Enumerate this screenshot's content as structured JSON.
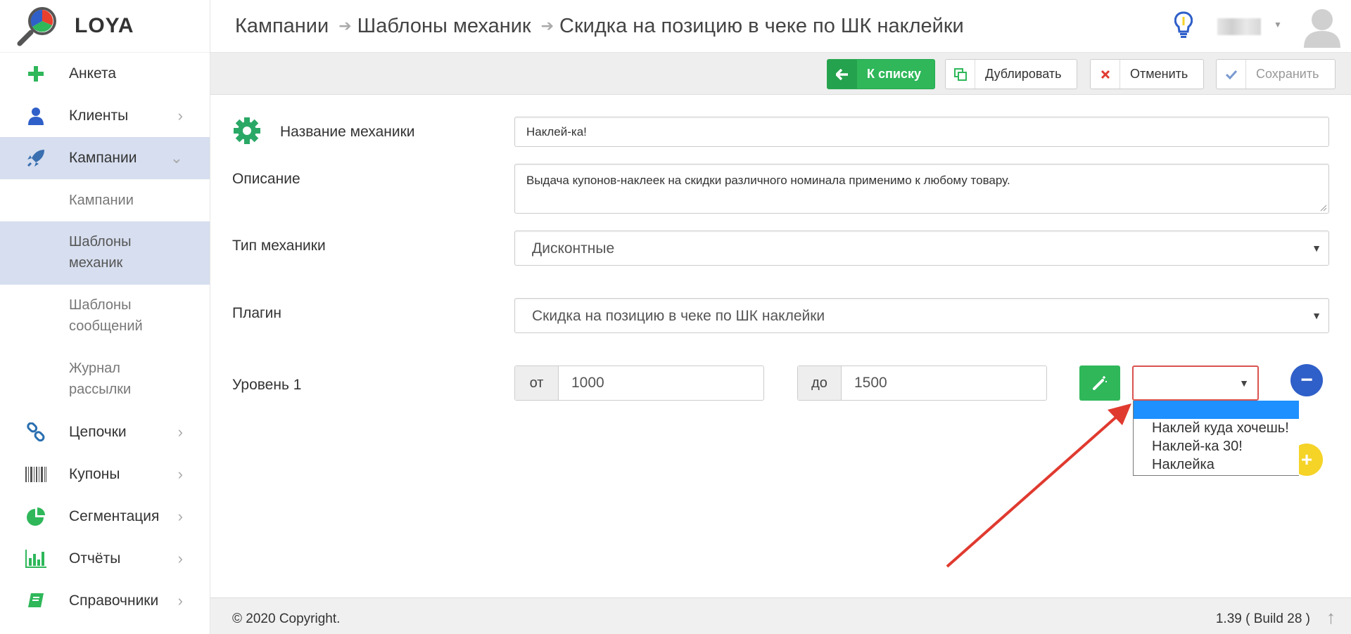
{
  "app": {
    "brand": "LOYA"
  },
  "sidebar": {
    "items": [
      {
        "label": "Анкета",
        "icon": "plus-icon",
        "color": "#2fb75a"
      },
      {
        "label": "Клиенты",
        "icon": "user-icon",
        "color": "#2f5fc8",
        "chevron": "›"
      },
      {
        "label": "Кампании",
        "icon": "rocket-icon",
        "color": "#3a6fb0",
        "chevron": "⌄",
        "active": true
      },
      {
        "label": "Цепочки",
        "icon": "chain-link-icon",
        "color": "#2a6fb0",
        "chevron": "›"
      },
      {
        "label": "Купоны",
        "icon": "barcode-icon",
        "color": "#555555",
        "chevron": "›"
      },
      {
        "label": "Сегментация",
        "icon": "pie-chart-icon",
        "color": "#2fb75a",
        "chevron": "›"
      },
      {
        "label": "Отчёты",
        "icon": "bar-chart-icon",
        "color": "#2fb75a",
        "chevron": "›"
      },
      {
        "label": "Справочники",
        "icon": "book-icon",
        "color": "#2fb75a",
        "chevron": "›"
      }
    ],
    "subitems": [
      {
        "label": "Кампании"
      },
      {
        "label_line1": "Шаблоны",
        "label_line2": "механик",
        "active": true
      },
      {
        "label_line1": "Шаблоны",
        "label_line2": "сообщений"
      },
      {
        "label_line1": "Журнал",
        "label_line2": "рассылки"
      }
    ]
  },
  "header": {
    "breadcrumb": [
      "Кампании",
      "Шаблоны механик",
      "Скидка на позицию в чеке по ШК наклейки"
    ],
    "breadcrumb_separator": "➔"
  },
  "toolbar": {
    "back_label": "К списку",
    "duplicate_label": "Дублировать",
    "cancel_label": "Отменить",
    "save_label": "Сохранить"
  },
  "form": {
    "name_label": "Название механики",
    "name_value": "Наклей-ка!",
    "description_label": "Описание",
    "description_value": "Выдача купонов-наклеек на скидки различного номинала применимо к любому товару.",
    "type_label": "Тип механики",
    "type_value": "Дисконтные",
    "plugin_label": "Плагин",
    "plugin_value": "Скидка на позицию в чеке по ШК наклейки",
    "level_label": "Уровень 1",
    "from_label": "от",
    "from_value": "1000",
    "to_label": "до",
    "to_value": "1500",
    "coupon_options": [
      "",
      "Наклей куда хочешь!",
      "Наклей-ка 30!",
      "Наклейка"
    ]
  },
  "footer": {
    "copyright": "© 2020 Copyright.",
    "version": "1.39 ( Build 28 )"
  },
  "colors": {
    "accent_green": "#2fb75a",
    "active_bg": "#d6deef",
    "annotation_red": "#e03a2f",
    "dropdown_highlight": "#1e90ff"
  }
}
